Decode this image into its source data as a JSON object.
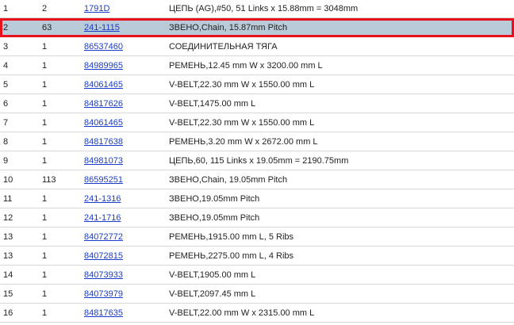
{
  "rows": [
    {
      "pos": "1",
      "qty": "2",
      "part": "1791D",
      "desc": "ЦЕПЬ (AG),#50, 51 Links x 15.88mm = 3048mm"
    },
    {
      "pos": "2",
      "qty": "63",
      "part": "241-1115",
      "desc": "ЗВЕНО,Chain, 15.87mm Pitch"
    },
    {
      "pos": "3",
      "qty": "1",
      "part": "86537460",
      "desc": "СОЕДИНИТЕЛЬНАЯ ТЯГА"
    },
    {
      "pos": "4",
      "qty": "1",
      "part": "84989965",
      "desc": "РЕМЕНЬ,12.45 mm W x 3200.00 mm L"
    },
    {
      "pos": "5",
      "qty": "1",
      "part": "84061465",
      "desc": "V-BELT,22.30 mm W x 1550.00 mm L"
    },
    {
      "pos": "6",
      "qty": "1",
      "part": "84817626",
      "desc": "V-BELT,1475.00 mm L"
    },
    {
      "pos": "7",
      "qty": "1",
      "part": "84061465",
      "desc": "V-BELT,22.30 mm W x 1550.00 mm L"
    },
    {
      "pos": "8",
      "qty": "1",
      "part": "84817638",
      "desc": "РЕМЕНЬ,3.20 mm W x 2672.00 mm L"
    },
    {
      "pos": "9",
      "qty": "1",
      "part": "84981073",
      "desc": "ЦЕПЬ,60, 115 Links x 19.05mm = 2190.75mm"
    },
    {
      "pos": "10",
      "qty": "113",
      "part": "86595251",
      "desc": "ЗВЕНО,Chain, 19.05mm Pitch"
    },
    {
      "pos": "11",
      "qty": "1",
      "part": "241-1316",
      "desc": "ЗВЕНО,19.05mm Pitch"
    },
    {
      "pos": "12",
      "qty": "1",
      "part": "241-1716",
      "desc": "ЗВЕНО,19.05mm Pitch"
    },
    {
      "pos": "13",
      "qty": "1",
      "part": "84072772",
      "desc": "РЕМЕНЬ,1915.00 mm L, 5 Ribs"
    },
    {
      "pos": "13",
      "qty": "1",
      "part": "84072815",
      "desc": "РЕМЕНЬ,2275.00 mm L, 4 Ribs"
    },
    {
      "pos": "14",
      "qty": "1",
      "part": "84073933",
      "desc": "V-BELT,1905.00 mm L"
    },
    {
      "pos": "15",
      "qty": "1",
      "part": "84073979",
      "desc": "V-BELT,2097.45 mm L"
    },
    {
      "pos": "16",
      "qty": "1",
      "part": "84817635",
      "desc": "V-BELT,22.00 mm W x 2315.00 mm L"
    }
  ]
}
